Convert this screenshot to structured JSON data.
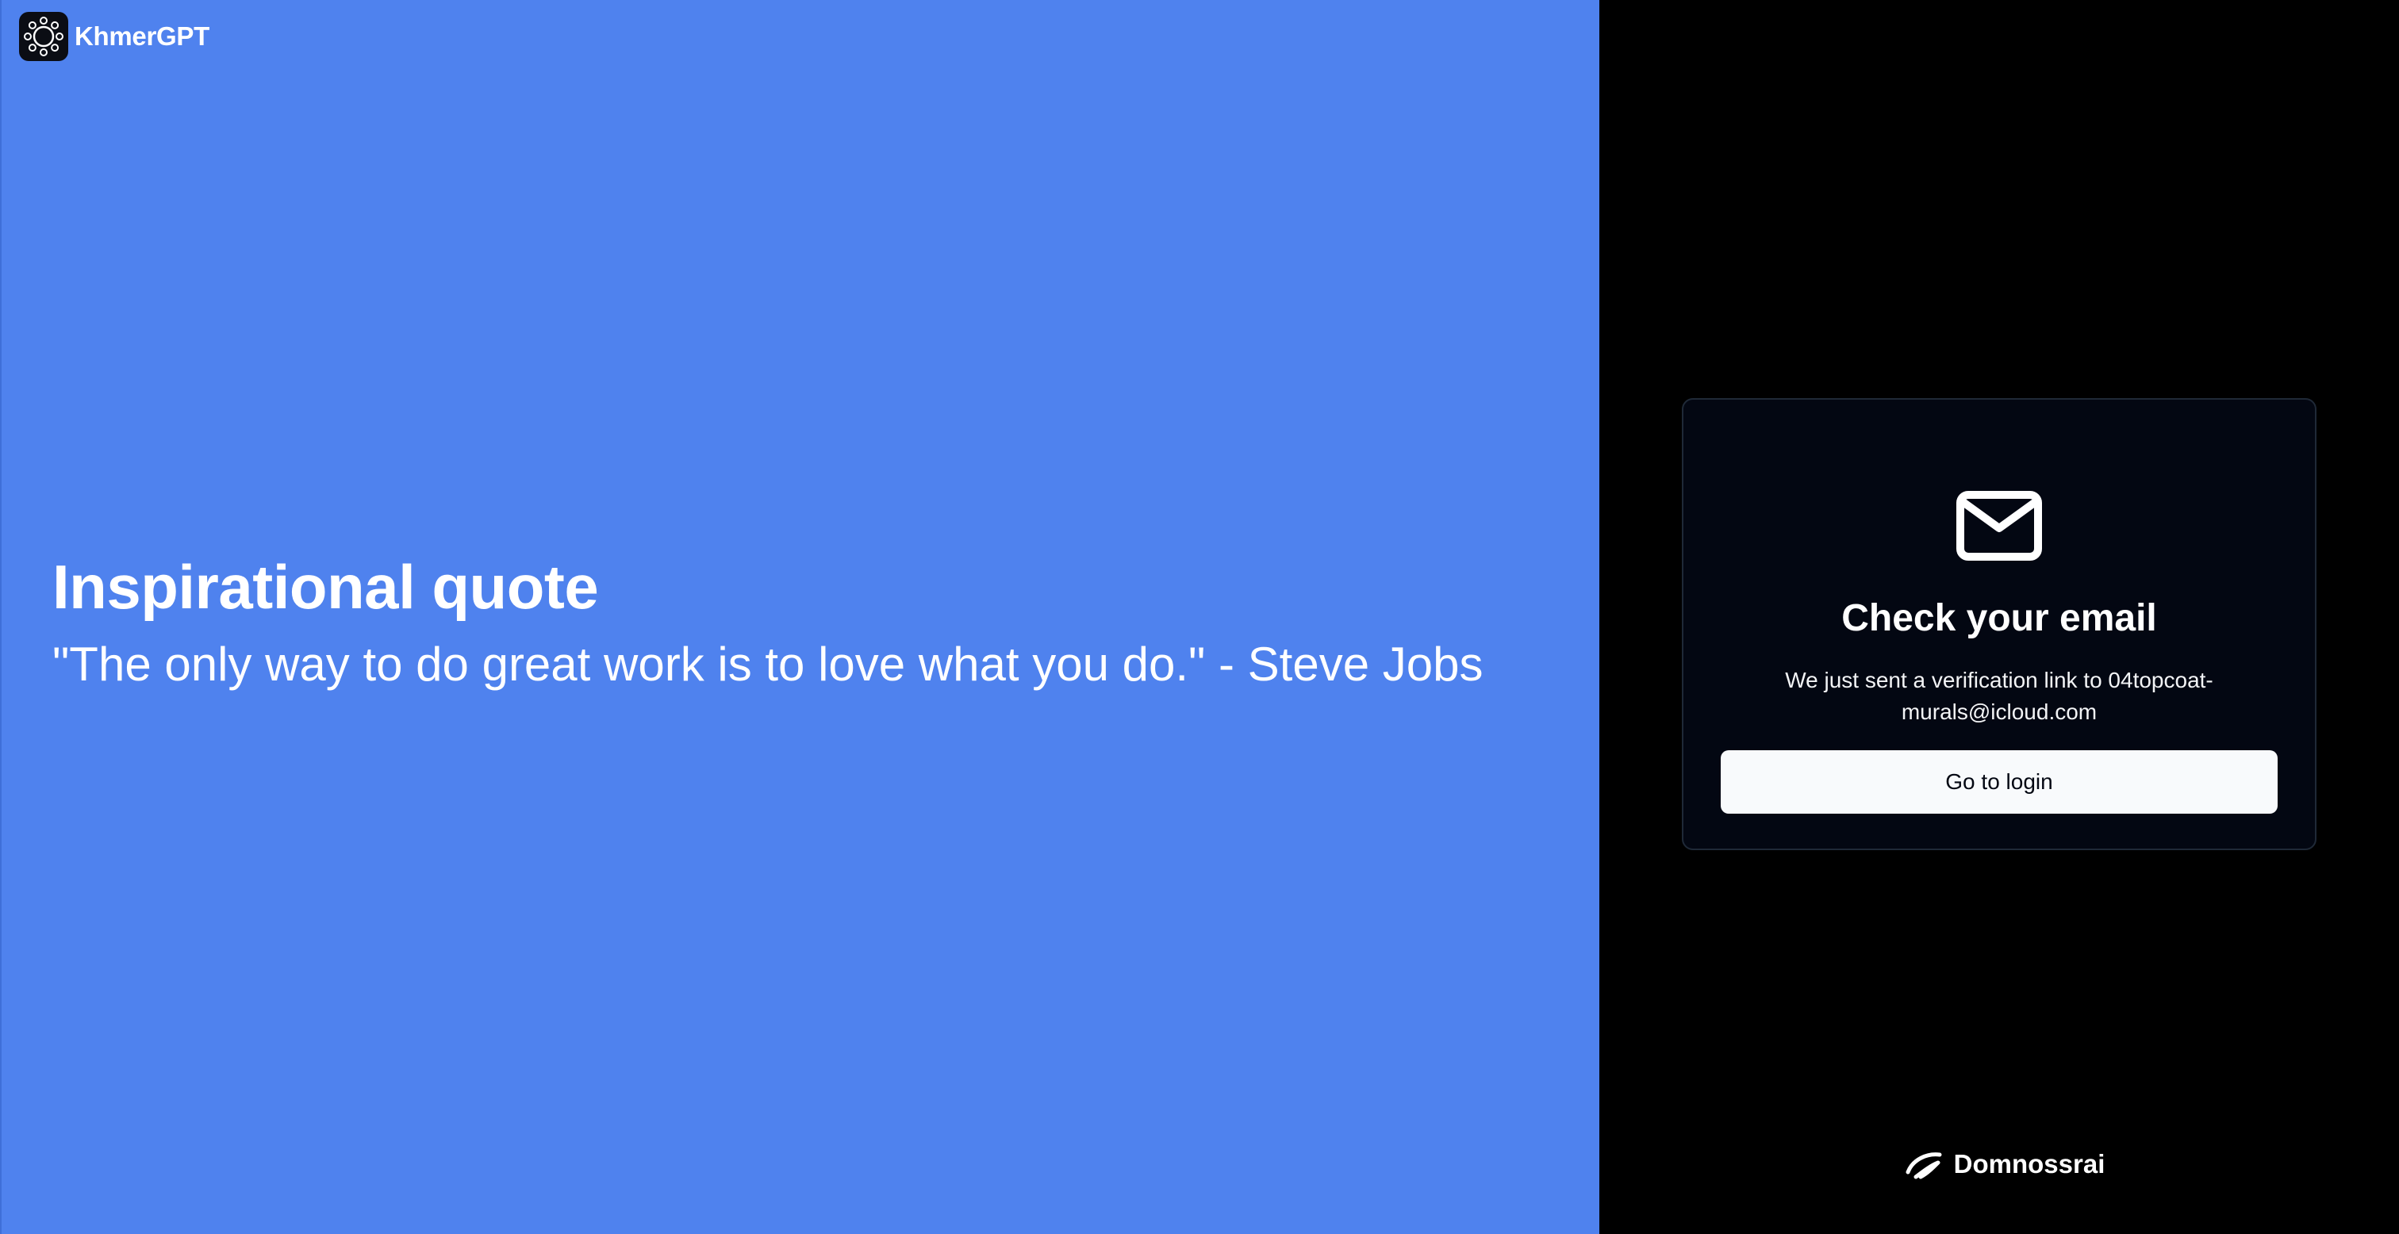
{
  "brand": {
    "name": "KhmerGPT",
    "logo_icon": "circle-of-dots-icon"
  },
  "quote": {
    "heading": "Inspirational quote",
    "text": "\"The only way to do great work is to love what you do.\" - Steve Jobs"
  },
  "card": {
    "icon": "mail-icon",
    "title": "Check your email",
    "message": "We just sent a verification link to 04topcoat-murals@icloud.com",
    "button_label": "Go to login"
  },
  "footer": {
    "brand_name": "Domnossrai",
    "logo_icon": "swoosh-logo-icon"
  },
  "colors": {
    "left_background": "#4f82ee",
    "right_background": "#000000",
    "card_background": "#030712",
    "card_border": "#1f2937",
    "button_background": "#f8fafc"
  }
}
